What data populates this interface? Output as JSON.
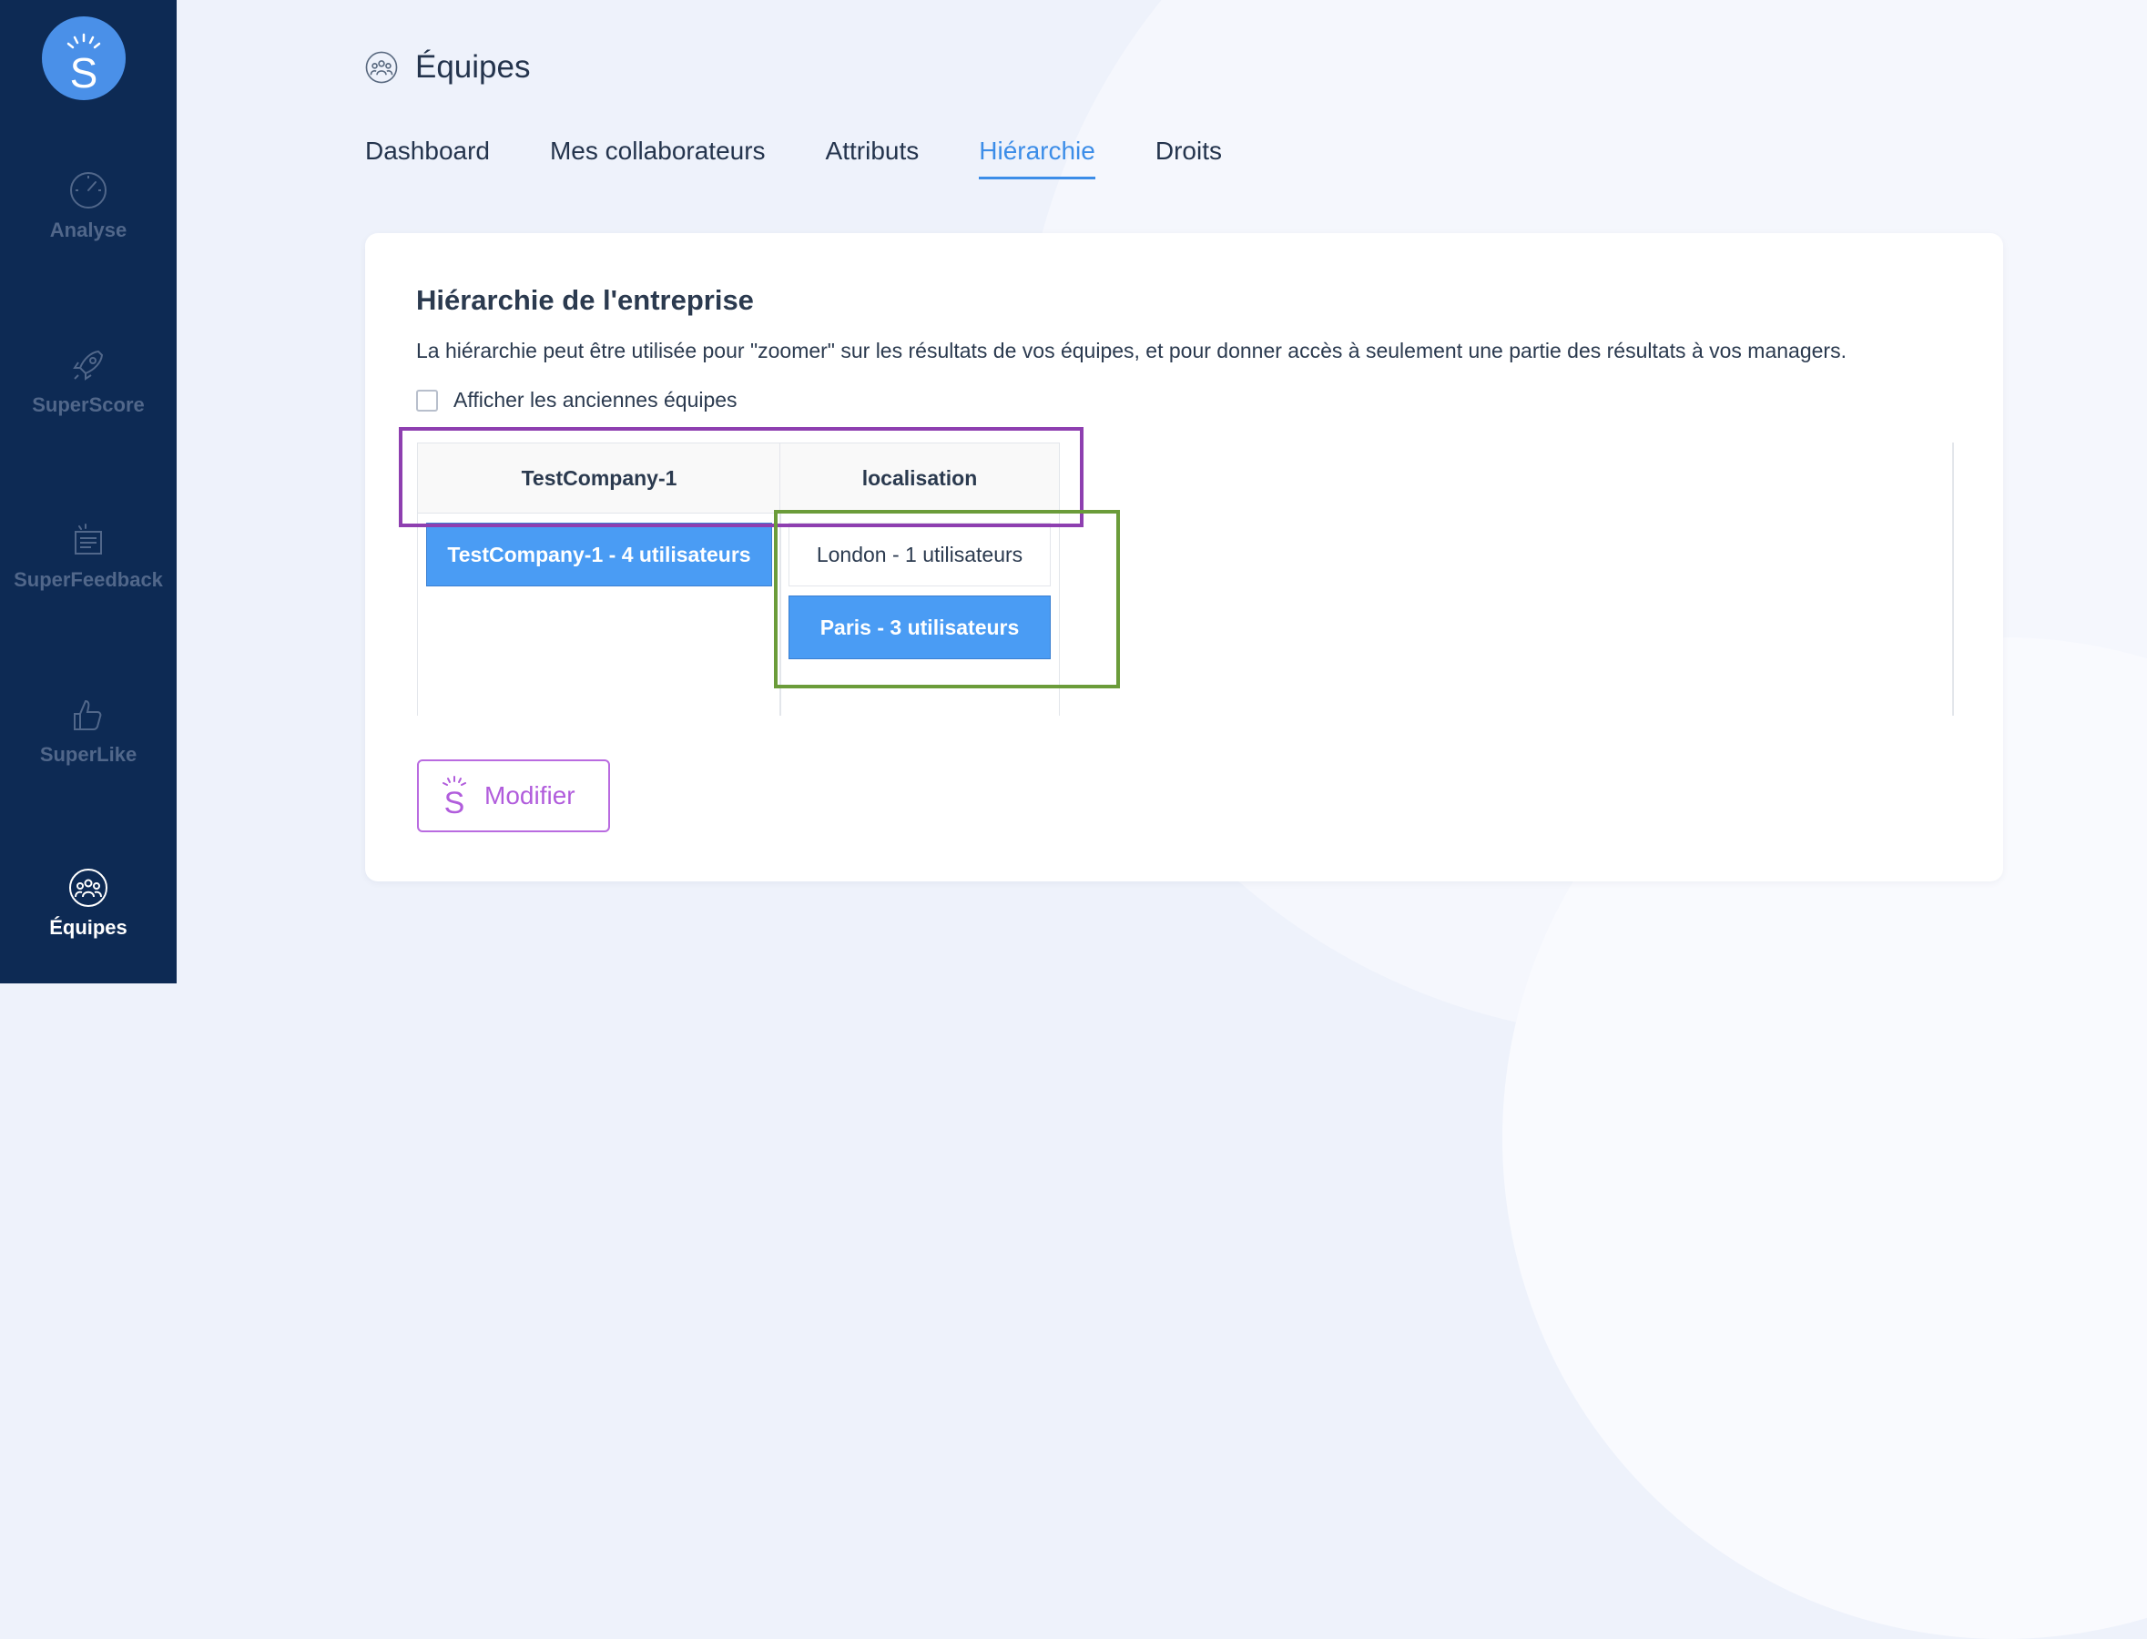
{
  "sidebar": {
    "logo_letter": "S",
    "items": [
      {
        "label": "Analyse",
        "icon": "gauge-icon"
      },
      {
        "label": "SuperScore",
        "icon": "rocket-icon"
      },
      {
        "label": "SuperFeedback",
        "icon": "feedback-icon"
      },
      {
        "label": "SuperLike",
        "icon": "thumbs-up-icon"
      },
      {
        "label": "Équipes",
        "icon": "team-icon",
        "active": true
      }
    ]
  },
  "header": {
    "title": "Équipes",
    "icon": "team-icon"
  },
  "tabs": [
    {
      "label": "Dashboard"
    },
    {
      "label": "Mes collaborateurs"
    },
    {
      "label": "Attributs"
    },
    {
      "label": "Hiérarchie",
      "active": true
    },
    {
      "label": "Droits"
    }
  ],
  "card": {
    "title": "Hiérarchie de l'entreprise",
    "description": "La hiérarchie peut être utilisée pour \"zoomer\" sur les résultats de vos équipes, et pour donner accès à seulement une partie des résultats à vos managers.",
    "checkbox_label": "Afficher les anciennes équipes",
    "checkbox_checked": false
  },
  "hierarchy": {
    "columns": [
      {
        "header": "TestCompany-1",
        "nodes": [
          {
            "label": "TestCompany-1 - 4 utilisateurs",
            "selected": true
          }
        ]
      },
      {
        "header": "localisation",
        "nodes": [
          {
            "label": "London - 1 utilisateurs",
            "selected": false
          },
          {
            "label": "Paris - 3 utilisateurs",
            "selected": true
          }
        ]
      }
    ]
  },
  "actions": {
    "modify_label": "Modifier"
  },
  "colors": {
    "sidebar_bg": "#0d2a54",
    "accent": "#3c8de8",
    "selected_node": "#4a9cf4",
    "modify_purple": "#b15ddc",
    "highlight_purple": "#8e3fb0",
    "highlight_green": "#6b9c3a"
  }
}
